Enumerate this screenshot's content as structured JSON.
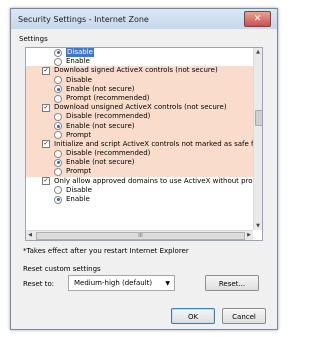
{
  "window": {
    "title": "Security Settings - Internet Zone",
    "close_glyph": "✕"
  },
  "settings_label": "Settings",
  "list": {
    "rows": [
      {
        "type": "radio",
        "level": "sub",
        "checked": true,
        "label": "Disable",
        "selected": true,
        "hl": false
      },
      {
        "type": "radio",
        "level": "sub",
        "checked": false,
        "label": "Enable",
        "selected": false,
        "hl": false
      },
      {
        "type": "head",
        "label": "Download signed ActiveX controls (not secure)",
        "hl": true
      },
      {
        "type": "radio",
        "level": "sub",
        "checked": false,
        "label": "Disable",
        "selected": false,
        "hl": true
      },
      {
        "type": "radio",
        "level": "sub",
        "checked": true,
        "label": "Enable (not secure)",
        "selected": false,
        "hl": true
      },
      {
        "type": "radio",
        "level": "sub",
        "checked": false,
        "label": "Prompt (recommended)",
        "selected": false,
        "hl": true
      },
      {
        "type": "head",
        "label": "Download unsigned ActiveX controls (not secure)",
        "hl": true
      },
      {
        "type": "radio",
        "level": "sub",
        "checked": false,
        "label": "Disable (recommended)",
        "selected": false,
        "hl": true
      },
      {
        "type": "radio",
        "level": "sub",
        "checked": true,
        "label": "Enable (not secure)",
        "selected": false,
        "hl": true
      },
      {
        "type": "radio",
        "level": "sub",
        "checked": false,
        "label": "Prompt",
        "selected": false,
        "hl": true
      },
      {
        "type": "head",
        "label": "Initialize and script ActiveX controls not marked as safe for s",
        "hl": true
      },
      {
        "type": "radio",
        "level": "sub",
        "checked": false,
        "label": "Disable (recommended)",
        "selected": false,
        "hl": true
      },
      {
        "type": "radio",
        "level": "sub",
        "checked": true,
        "label": "Enable (not secure)",
        "selected": false,
        "hl": true
      },
      {
        "type": "radio",
        "level": "sub",
        "checked": false,
        "label": "Prompt",
        "selected": false,
        "hl": true
      },
      {
        "type": "head",
        "label": "Only allow approved domains to use ActiveX without prompt",
        "hl": false
      },
      {
        "type": "radio",
        "level": "sub",
        "checked": false,
        "label": "Disable",
        "selected": false,
        "hl": false
      },
      {
        "type": "radio",
        "level": "sub",
        "checked": true,
        "label": "Enable",
        "selected": false,
        "hl": false
      }
    ],
    "hscroll_grip": "III"
  },
  "note": "*Takes effect after you restart Internet Explorer",
  "reset": {
    "group_label": "Reset custom settings",
    "to_label": "Reset to:",
    "selected_level": "Medium-high (default)",
    "reset_button": "Reset..."
  },
  "buttons": {
    "ok": "OK",
    "cancel": "Cancel"
  },
  "icons": {
    "check": "✓",
    "scroll_up": "▲",
    "scroll_down": "▼",
    "scroll_left": "◀",
    "scroll_right": "▶",
    "dropdown": "▼"
  },
  "colors": {
    "highlight": "#f9dccb",
    "selection": "#3a77d0"
  }
}
